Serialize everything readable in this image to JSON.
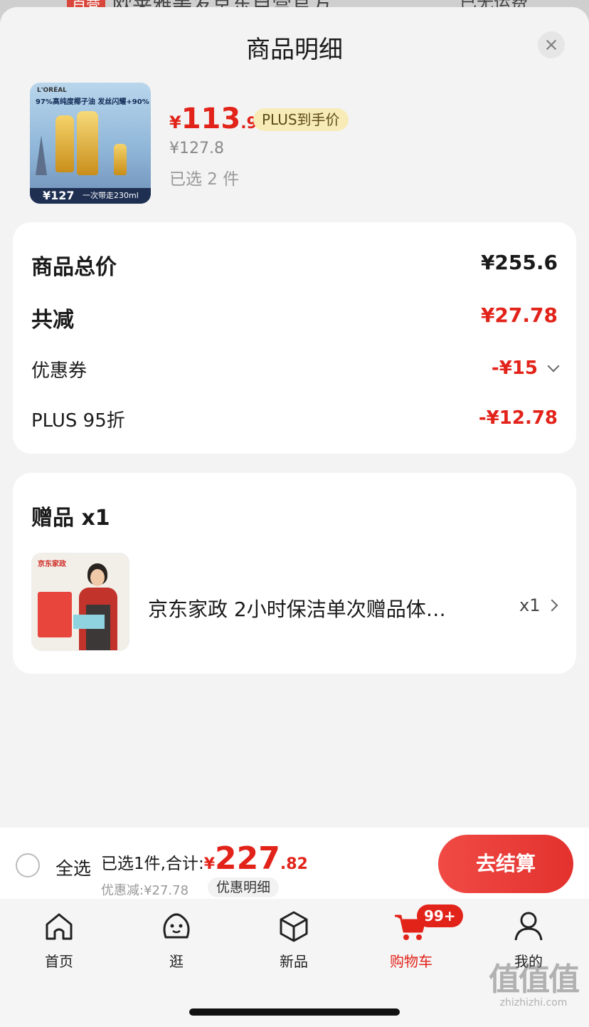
{
  "behind": {
    "store_badge": "自营",
    "store_title": "欧莱雅美发京东自营官方…",
    "right_text": "已无运费"
  },
  "sheet": {
    "title": "商品明细",
    "close_icon": "close-icon"
  },
  "product": {
    "image_alt_lines": {
      "brand": "L'ORÉAL",
      "headline": "97%高纯度椰子油 发丝闪耀+90%",
      "strip_price": "¥127",
      "strip_volume": "一次带走230ml"
    },
    "price_symbol": "¥",
    "price_int": "113",
    "price_dec": ".91",
    "plus_tag": "PLUS到手价",
    "original_price": "¥127.8",
    "selected": "已选 2 件"
  },
  "summary_card": {
    "total_label": "商品总价",
    "total_value": "¥255.6",
    "discount_label": "共减",
    "discount_value": "¥27.78",
    "coupon_label": "优惠券",
    "coupon_value": "-¥15",
    "plus_label": "PLUS 95折",
    "plus_value": "-¥12.78"
  },
  "gift_card": {
    "title": "赠品 x1",
    "image_label": "京东家政",
    "name": "京东家政 2小时保洁单次赠品体…",
    "qty": "x1"
  },
  "bottom_bar": {
    "select_all": "全选",
    "summary_label": "已选1件,合计:",
    "total_symbol": "¥",
    "total_int": "227",
    "total_dec": ".82",
    "discount_text": "优惠减:¥27.78",
    "detail_button": "优惠明细",
    "checkout_button": "去结算"
  },
  "tabbar": {
    "tabs": [
      {
        "label": "首页",
        "icon": "home-icon"
      },
      {
        "label": "逛",
        "icon": "face-icon"
      },
      {
        "label": "新品",
        "icon": "cube-icon"
      },
      {
        "label": "购物车",
        "icon": "cart-icon"
      },
      {
        "label": "我的",
        "icon": "user-icon"
      }
    ],
    "cart_badge": "99+",
    "active_color": "#e2231a"
  },
  "watermark": {
    "big": "值值值",
    "small": "zhizhizhi.com"
  }
}
